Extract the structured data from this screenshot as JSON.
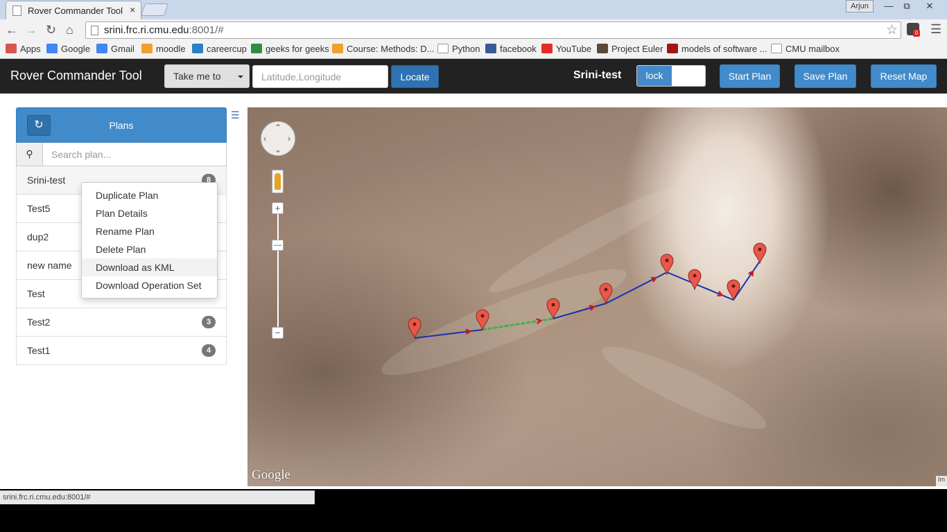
{
  "browser": {
    "tab_title": "Rover Commander Tool",
    "tab_close": "×",
    "profile": "Arjun",
    "win_min": "—",
    "win_max": "⧉",
    "win_close": "✕",
    "url_host": "srini.frc.ri.cmu.edu",
    "url_rest": ":8001/#",
    "status_url": "srini.frc.ri.cmu.edu:8001/#",
    "ext_badge": "0",
    "bookmarks": [
      {
        "label": "Apps",
        "icon": "apps-icon",
        "color": "#d9534f"
      },
      {
        "label": "Google",
        "icon": "google-icon",
        "color": "#4285f4"
      },
      {
        "label": "Gmail",
        "icon": "gmail-icon",
        "color": "#4285f4"
      },
      {
        "label": "moodle",
        "icon": "moodle-icon",
        "color": "#f0a030"
      },
      {
        "label": "careercup",
        "icon": "careercup-icon",
        "color": "#2a7fc9"
      },
      {
        "label": "geeks for geeks",
        "icon": "geeksforgeeks-icon",
        "color": "#2f8d46"
      },
      {
        "label": "Course: Methods: D...",
        "icon": "moodle-icon",
        "color": "#f0a030"
      },
      {
        "label": "Python",
        "icon": "page-icon",
        "color": "#ffffff"
      },
      {
        "label": "facebook",
        "icon": "facebook-icon",
        "color": "#3b5998"
      },
      {
        "label": "YouTube",
        "icon": "youtube-icon",
        "color": "#e52d27"
      },
      {
        "label": "Project Euler",
        "icon": "projecteuler-icon",
        "color": "#5a4a3a"
      },
      {
        "label": "models of software ...",
        "icon": "course-c-icon",
        "color": "#a31515"
      },
      {
        "label": "CMU mailbox",
        "icon": "mail-icon",
        "color": "#ffffff"
      }
    ]
  },
  "app": {
    "brand": "Rover Commander Tool",
    "take_me_to": "Take me to",
    "coord_placeholder": "Latitude,Longitude",
    "locate": "Locate",
    "plan_name": "Srini-test",
    "lock": "lock",
    "start_plan": "Start Plan",
    "save_plan": "Save Plan",
    "reset_map": "Reset Map",
    "accent": "#428bca",
    "navbar_bg": "#222222"
  },
  "plans": {
    "title": "Plans",
    "search_placeholder": "Search plan...",
    "items": [
      {
        "name": "Srini-test",
        "count": "8"
      },
      {
        "name": "Test5",
        "count": ""
      },
      {
        "name": "dup2",
        "count": ""
      },
      {
        "name": "new name",
        "count": ""
      },
      {
        "name": "Test",
        "count": ""
      },
      {
        "name": "Test2",
        "count": "3"
      },
      {
        "name": "Test1",
        "count": "4"
      }
    ]
  },
  "context_menu": {
    "items": [
      "Duplicate Plan",
      "Plan Details",
      "Rename Plan",
      "Delete Plan",
      "Download as KML",
      "Download Operation Set"
    ],
    "highlighted": "Download as KML"
  },
  "map": {
    "attribution": "Google",
    "marker_count": 8,
    "path_color": "#1a2eb0",
    "arrow_color": "#d21b1b",
    "active_segment_color": "#3ab54a",
    "marker_color": "#e8574a"
  }
}
